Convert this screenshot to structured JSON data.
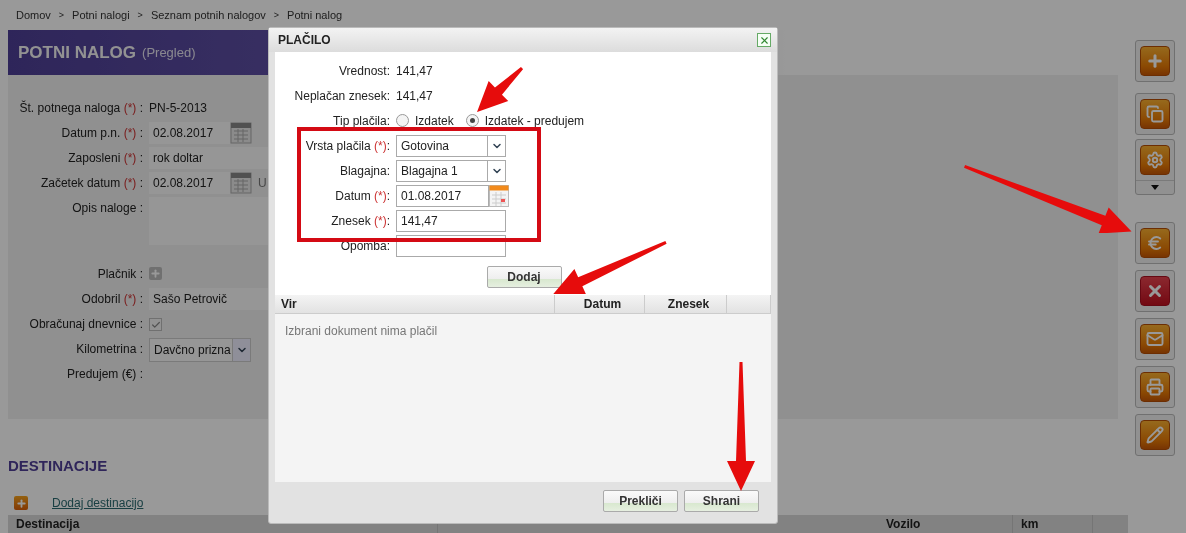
{
  "breadcrumbs": [
    "Domov",
    "Potni nalogi",
    "Seznam potnih nalogov",
    "Potni nalog"
  ],
  "breadcrumb_separator": ">",
  "header": {
    "title": "POTNI NALOG",
    "subtitle": "(Pregled)"
  },
  "form": [
    {
      "kind": "text",
      "label": "Št. potnega naloga",
      "required_mark": "(*)",
      "colon": ":",
      "value": "PN-5-2013"
    },
    {
      "kind": "date",
      "label": "Datum p.n.",
      "required_mark": "(*)",
      "colon": ":",
      "value": "02.08.2017"
    },
    {
      "kind": "input",
      "label": "Zaposleni",
      "required_mark": "(*)",
      "colon": ":",
      "value": "rok doltar"
    },
    {
      "kind": "date",
      "label": "Začetek datum",
      "required_mark": "(*)",
      "colon": ":",
      "value": "02.08.2017",
      "after": "U"
    },
    {
      "kind": "textarea",
      "label": "Opis naloge",
      "colon": ":"
    },
    {
      "kind": "add",
      "label": "Plačnik",
      "colon": ":"
    },
    {
      "kind": "input",
      "label": "Odobril",
      "required_mark": "(*)",
      "colon": ":",
      "value": "Sašo Petrovič"
    },
    {
      "kind": "checkbox",
      "label": "Obračunaj dnevnice",
      "colon": ":",
      "checked": true
    },
    {
      "kind": "select",
      "label": "Kilometrina",
      "colon": ":",
      "value": "Davčno prizna"
    },
    {
      "kind": "empty",
      "label": "Predujem (€)",
      "colon": ":"
    }
  ],
  "destinations": {
    "title": "DESTINACIJE",
    "add_link": "Dodaj destinacijo",
    "columns": [
      "Destinacija",
      "Vozilo",
      "km"
    ]
  },
  "toolbar": [
    {
      "kind": "plus"
    },
    {
      "kind": "copy"
    },
    {
      "kind": "gear",
      "dropdown": true
    },
    {
      "kind": "euro"
    },
    {
      "kind": "delete"
    },
    {
      "kind": "mail"
    },
    {
      "kind": "print"
    },
    {
      "kind": "edit"
    }
  ],
  "dialog": {
    "title": "PLAČILO",
    "info": [
      {
        "label": "Vrednost",
        "colon": ":",
        "value": "141,47"
      },
      {
        "label": "Neplačan znesek",
        "colon": ":",
        "value": "141,47"
      }
    ],
    "payment_type": {
      "label": "Tip plačila",
      "colon": ":",
      "options": [
        {
          "label": "Izdatek",
          "selected": false
        },
        {
          "label": "Izdatek - predujem",
          "selected": true
        }
      ]
    },
    "fields": [
      {
        "kind": "select",
        "label": "Vrsta plačila",
        "required_mark": "(*)",
        "colon": ":",
        "value": "Gotovina"
      },
      {
        "kind": "select",
        "label": "Blagajna",
        "colon": ":",
        "value": "Blagajna 1"
      },
      {
        "kind": "date",
        "label": "Datum",
        "required_mark": "(*)",
        "colon": ":",
        "value": "01.08.2017"
      },
      {
        "kind": "input",
        "label": "Znesek",
        "required_mark": "(*)",
        "colon": ":",
        "value": "141,47"
      },
      {
        "kind": "input",
        "label": "Opomba",
        "colon": ":"
      }
    ],
    "add_button": "Dodaj",
    "grid": {
      "columns": [
        "Vir",
        "Datum",
        "Znesek"
      ],
      "empty_message": "Izbrani dokument nima plačil"
    },
    "buttons": [
      "Prekliči",
      "Shrani"
    ]
  }
}
